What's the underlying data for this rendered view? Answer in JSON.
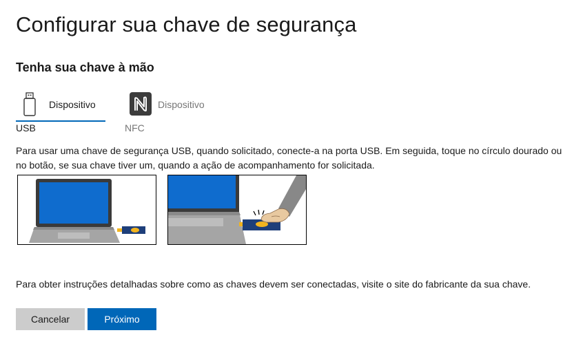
{
  "page": {
    "title": "Configurar sua chave de segurança",
    "subtitle": "Tenha sua chave à mão"
  },
  "tabs": [
    {
      "label": "Dispositivo",
      "caption": "USB",
      "icon": "usb-drive-icon",
      "selected": true
    },
    {
      "label": "Dispositivo",
      "caption": "NFC",
      "icon": "nfc-icon",
      "selected": false
    }
  ],
  "instructions": {
    "text": "Para usar uma chave de segurança USB, quando solicitado, conecte-a na porta USB. Em seguida, toque no círculo dourado ou no botão, se sua chave tiver um, quando a ação de acompanhamento for solicitada."
  },
  "illustrations": [
    {
      "icon": "laptop-with-usb-key-illustration"
    },
    {
      "icon": "finger-touching-usb-key-illustration"
    }
  ],
  "note": {
    "text": "Para obter instruções detalhadas sobre como as chaves devem ser conectadas, visite o site do fabricante da sua chave."
  },
  "buttons": {
    "cancel_label": "Cancelar",
    "next_label": "Próximo"
  },
  "colors": {
    "accent": "#0067b8",
    "secondary_button": "#cccccc",
    "screen_blue": "#0f6cce",
    "key_navy": "#1e3f7a",
    "key_gold": "#f2b41f"
  }
}
